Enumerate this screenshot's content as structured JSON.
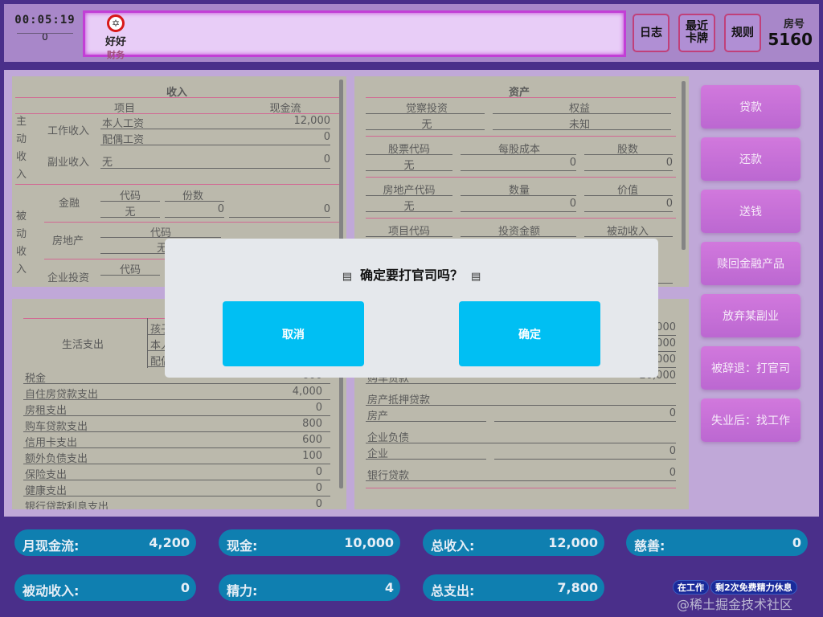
{
  "header": {
    "timer": "00:05:19",
    "timer_sub": "0",
    "player": {
      "icon": "star-of-david-icon",
      "glyph": "✡",
      "name": "好好",
      "role": "财务"
    },
    "buttons": {
      "log": "日志",
      "recent_cards": "最近卡牌",
      "rules": "规则"
    },
    "room_label": "房号",
    "room_number": "5160"
  },
  "income": {
    "title": "收入",
    "col_item": "项目",
    "col_cashflow": "现金流",
    "active_label": "主动收入",
    "passive_label": "被动收入",
    "work_income": "工作收入",
    "self_salary": "本人工资",
    "self_salary_value": "12,000",
    "spouse_salary": "配偶工资",
    "spouse_salary_value": "0",
    "side_income": "副业收入",
    "side_income_item": "无",
    "side_income_value": "0",
    "finance": "金融",
    "finance_code": "代码",
    "finance_shares": "份数",
    "finance_code_value": "无",
    "finance_shares_value": "0",
    "finance_value": "0",
    "real_estate": "房地产",
    "real_estate_code": "代码",
    "real_estate_code_value": "无",
    "business": "企业投资",
    "business_code": "代码"
  },
  "assets": {
    "title": "资产",
    "awakening": "觉察投资",
    "equity": "权益",
    "awakening_value": "无",
    "equity_value": "未知",
    "stock_code": "股票代码",
    "cost_per_share": "每股成本",
    "shares": "股数",
    "stock_code_value": "无",
    "cost_per_share_value": "0",
    "shares_value": "0",
    "re_code": "房地产代码",
    "quantity": "数量",
    "worth": "价值",
    "re_code_value": "无",
    "quantity_value": "0",
    "worth_value": "0",
    "project_code": "项目代码",
    "invest_amount": "投资金额",
    "passive_income": "被动收入"
  },
  "expenses": {
    "living": "生活支出",
    "child": "孩子",
    "self": "本人",
    "spouse": "配偶",
    "rows": [
      {
        "label": "税金",
        "value": "600"
      },
      {
        "label": "自住房贷款支出",
        "value": "4,000"
      },
      {
        "label": "房租支出",
        "value": "0"
      },
      {
        "label": "购车贷款支出",
        "value": "800"
      },
      {
        "label": "信用卡支出",
        "value": "600"
      },
      {
        "label": "额外负债支出",
        "value": "100"
      },
      {
        "label": "保险支出",
        "value": "0"
      },
      {
        "label": "健康支出",
        "value": "0"
      },
      {
        "label": "银行贷款利息支出",
        "value": "0"
      }
    ]
  },
  "liabilities": {
    "values_top": [
      "000",
      "000",
      "000"
    ],
    "car_loan": "购车贷款",
    "car_loan_value": "20,000",
    "property_mortgage": "房产抵押贷款",
    "property": "房产",
    "property_value": "0",
    "business_debt": "企业负债",
    "business": "企业",
    "business_value": "0",
    "bank_loan": "银行贷款",
    "bank_loan_value": "0"
  },
  "actions": [
    "贷款",
    "还款",
    "送钱",
    "赎回金融产品",
    "放弃某副业",
    "被辞退：打官司",
    "失业后：找工作"
  ],
  "dialog": {
    "icon": "document-icon",
    "title": "确定要打官司吗？",
    "cancel": "取消",
    "confirm": "确定"
  },
  "stats": {
    "monthly_cashflow_label": "月现金流:",
    "monthly_cashflow": "4,200",
    "cash_label": "现金:",
    "cash": "10,000",
    "total_income_label": "总收入:",
    "total_income": "12,000",
    "charity_label": "慈善:",
    "charity": "0",
    "passive_income_label": "被动收入:",
    "passive_income": "0",
    "energy_label": "精力:",
    "energy": "4",
    "total_expense_label": "总支出:",
    "total_expense": "7,800"
  },
  "status": {
    "working": "在工作",
    "free_rest": "剩2次免费精力休息"
  },
  "watermark": "@稀土掘金技术社区",
  "colors": {
    "accent": "#c045d0",
    "dialog_button": "#00bff3",
    "stat_pill": "#0f7fb0",
    "panel": "#a19f8c",
    "background": "#a887c9"
  }
}
